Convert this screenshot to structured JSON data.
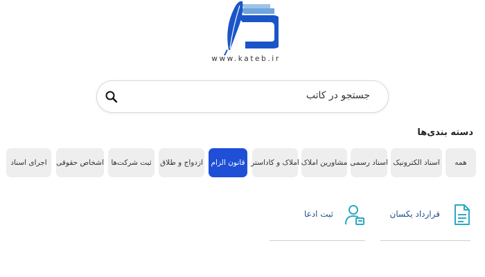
{
  "logo": {
    "url_text": "www.kateb.ir"
  },
  "search": {
    "placeholder": "جستجو در کاتب"
  },
  "categories": {
    "title": "دسته بندی‌ها",
    "items": [
      {
        "label": "همه",
        "active": false
      },
      {
        "label": "اسناد الکترونیک",
        "active": false
      },
      {
        "label": "اسناد رسمی",
        "active": false
      },
      {
        "label": "مشاورین املاک",
        "active": false
      },
      {
        "label": "املاک و کاداستر",
        "active": false
      },
      {
        "label": "قانون الزام",
        "active": true
      },
      {
        "label": "ازدواج و طلاق",
        "active": false
      },
      {
        "label": "ثبت شرکت‌ها",
        "active": false
      },
      {
        "label": "اشخاص حقوقی",
        "active": false
      },
      {
        "label": "اجرای اسناد",
        "active": false
      }
    ]
  },
  "cards": [
    {
      "label": "قرارداد یکسان",
      "icon": "document-icon"
    },
    {
      "label": "ثبت ادعا",
      "icon": "user-claim-icon"
    }
  ],
  "colors": {
    "accent": "#1e4fd6",
    "card_text": "#1f4e8c",
    "icon_teal": "#2aa8c4",
    "chip_bg": "#eeeeee"
  }
}
